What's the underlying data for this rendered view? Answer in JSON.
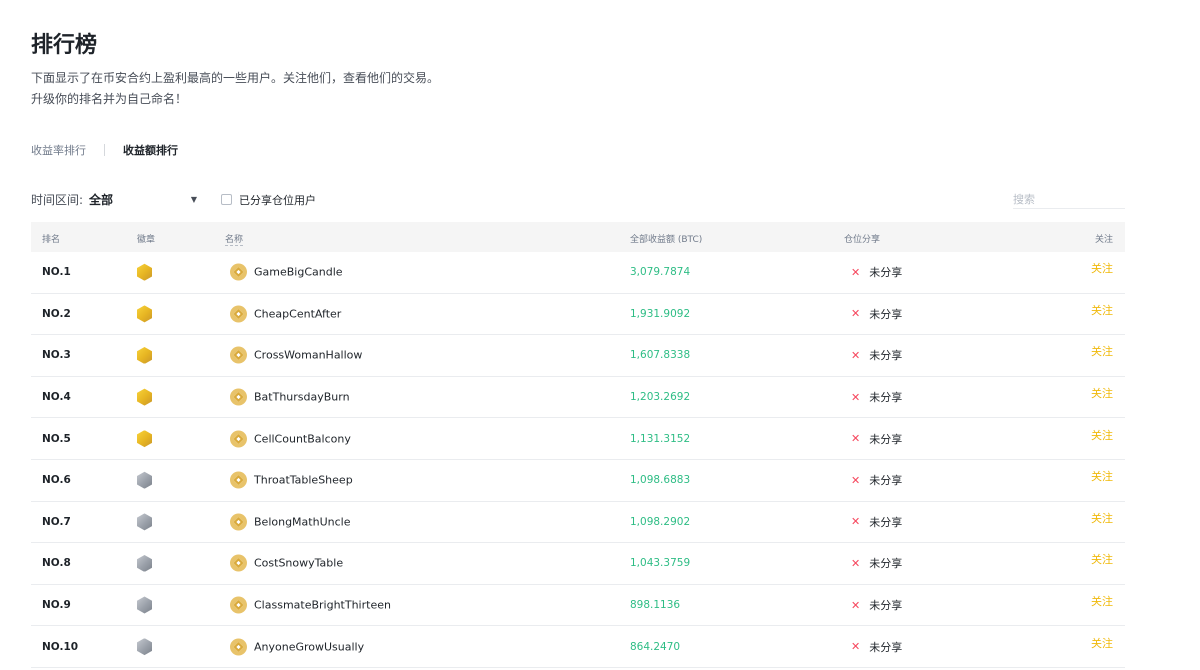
{
  "page": {
    "title": "排行榜",
    "desc_line1": "下面显示了在币安合约上盈利最高的一些用户。关注他们，查看他们的交易。",
    "desc_line2": "升级你的排名并为自己命名！"
  },
  "tabs": [
    {
      "label": "收益率排行",
      "active": false
    },
    {
      "label": "收益额排行",
      "active": true
    }
  ],
  "filters": {
    "period_label": "时间区间:",
    "period_value": "全部",
    "shared_label": "已分享仓位用户",
    "search_placeholder": "搜索"
  },
  "columns": {
    "rank": "排名",
    "badge": "徽章",
    "name": "名称",
    "profit": "全部收益额 (BTC)",
    "share": "仓位分享",
    "follow": "关注"
  },
  "rows": [
    {
      "rank": "NO.1",
      "badge": "gold",
      "name": "GameBigCandle",
      "profit": "3,079.7874",
      "share": "未分享",
      "follow": "关注"
    },
    {
      "rank": "NO.2",
      "badge": "gold",
      "name": "CheapCentAfter",
      "profit": "1,931.9092",
      "share": "未分享",
      "follow": "关注"
    },
    {
      "rank": "NO.3",
      "badge": "gold",
      "name": "CrossWomanHallow",
      "profit": "1,607.8338",
      "share": "未分享",
      "follow": "关注"
    },
    {
      "rank": "NO.4",
      "badge": "gold",
      "name": "BatThursdayBurn",
      "profit": "1,203.2692",
      "share": "未分享",
      "follow": "关注"
    },
    {
      "rank": "NO.5",
      "badge": "gold",
      "name": "CellCountBalcony",
      "profit": "1,131.3152",
      "share": "未分享",
      "follow": "关注"
    },
    {
      "rank": "NO.6",
      "badge": "silver",
      "name": "ThroatTableSheep",
      "profit": "1,098.6883",
      "share": "未分享",
      "follow": "关注"
    },
    {
      "rank": "NO.7",
      "badge": "silver",
      "name": "BelongMathUncle",
      "profit": "1,098.2902",
      "share": "未分享",
      "follow": "关注"
    },
    {
      "rank": "NO.8",
      "badge": "silver",
      "name": "CostSnowyTable",
      "profit": "1,043.3759",
      "share": "未分享",
      "follow": "关注"
    },
    {
      "rank": "NO.9",
      "badge": "silver",
      "name": "ClassmateBrightThirteen",
      "profit": "898.1136",
      "share": "未分享",
      "follow": "关注"
    },
    {
      "rank": "NO.10",
      "badge": "silver",
      "name": "AnyoneGrowUsually",
      "profit": "864.2470",
      "share": "未分享",
      "follow": "关注"
    }
  ],
  "colors": {
    "profit": "#2ebd85",
    "follow": "#f0b90b",
    "not_shared_icon": "#f6465d"
  }
}
